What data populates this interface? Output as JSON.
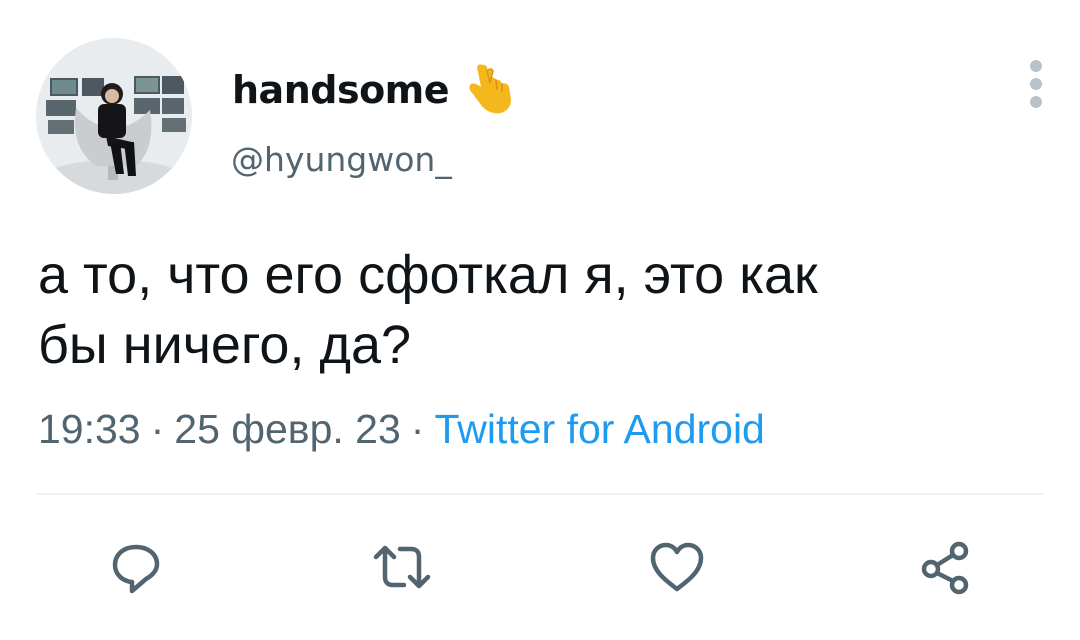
{
  "author": {
    "display_name": "handsome",
    "handle": "@hyungwon_",
    "emoji_icon": "crossed-fingers-heart-icon",
    "avatar_icon": "profile-photo"
  },
  "tweet": {
    "text_line1": "а то, что его сфоткал я, это как",
    "text_line2": "бы ничего, да?"
  },
  "meta": {
    "time": "19:33",
    "separator": "·",
    "date": "25 февр. 23",
    "source": "Twitter for Android"
  },
  "actions": {
    "reply_icon": "reply-icon",
    "retweet_icon": "retweet-icon",
    "like_icon": "heart-icon",
    "share_icon": "share-icon"
  },
  "colors": {
    "text": "#0f1419",
    "secondary": "#536471",
    "link": "#1d9bf0",
    "divider": "#eff3f4",
    "emoji": "#f5b81c"
  }
}
